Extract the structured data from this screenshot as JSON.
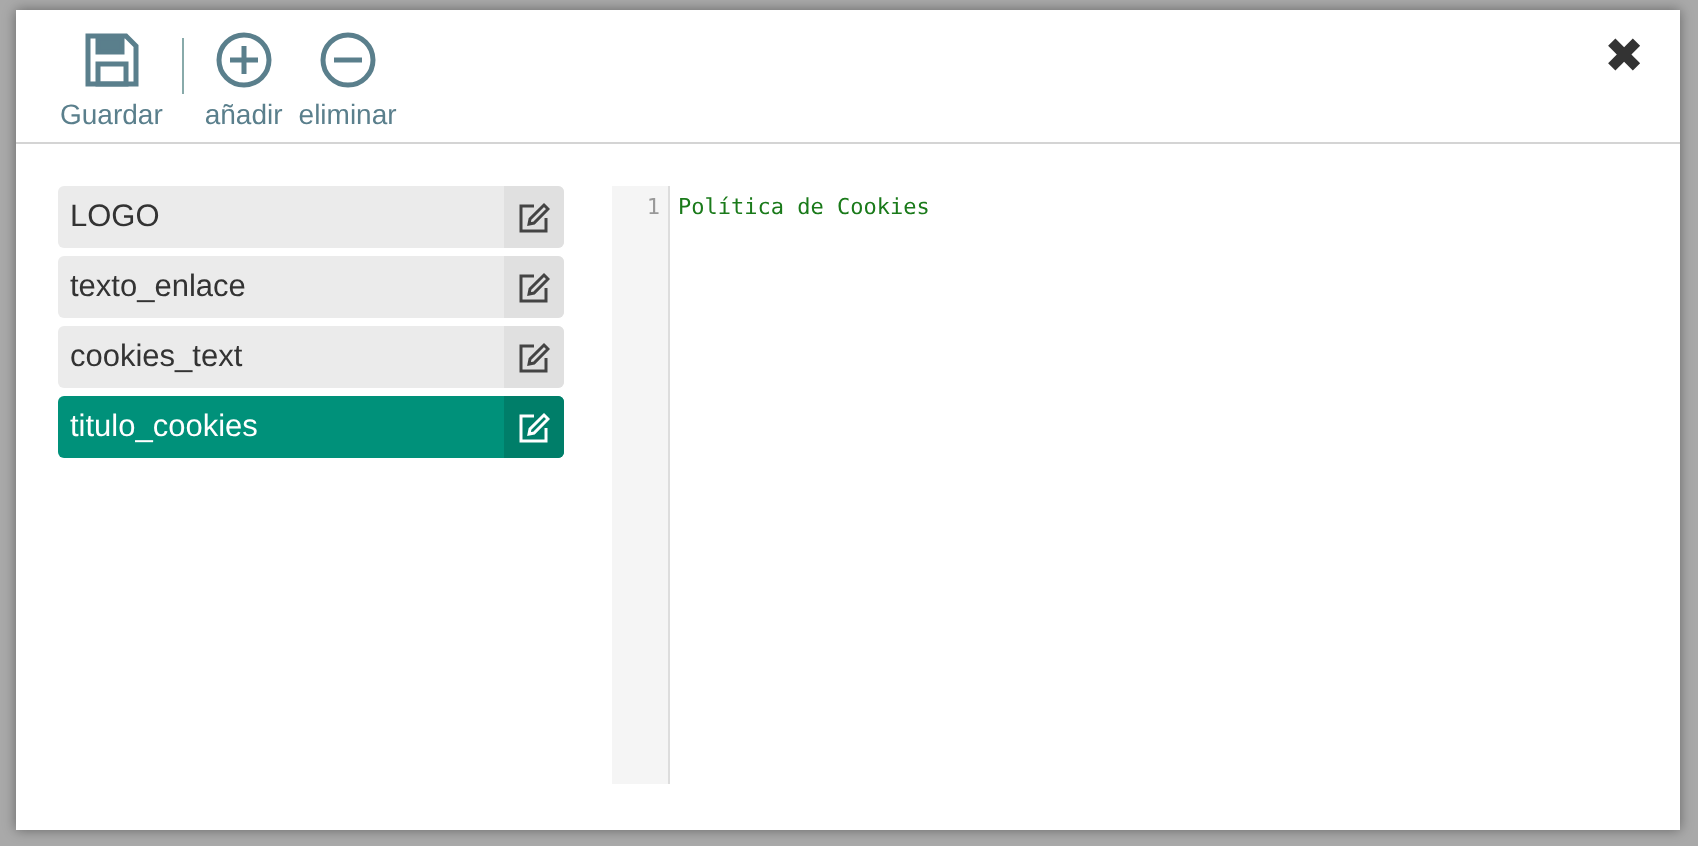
{
  "toolbar": {
    "buttons": [
      {
        "kind": "save",
        "label": "Guardar"
      },
      {
        "kind": "add",
        "label": "añadir"
      },
      {
        "kind": "remove",
        "label": "eliminar"
      }
    ],
    "close": "✖"
  },
  "items": [
    {
      "label": "LOGO",
      "selected": false
    },
    {
      "label": "texto_enlace",
      "selected": false
    },
    {
      "label": "cookies_text",
      "selected": false
    },
    {
      "label": "titulo_cookies",
      "selected": true
    }
  ],
  "editor": {
    "lines": [
      {
        "number": "1",
        "text": "Política de Cookies"
      }
    ]
  }
}
